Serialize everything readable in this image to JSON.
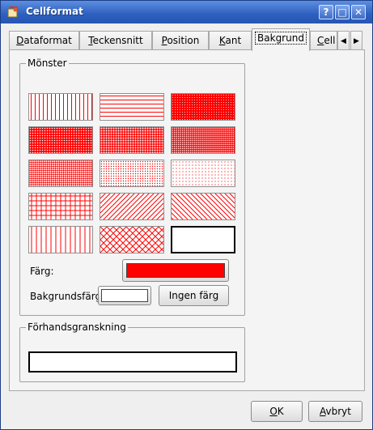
{
  "window": {
    "title": "Cellformat",
    "controls": {
      "help": "?",
      "maximize": "□",
      "close": "✕"
    }
  },
  "tabs": [
    {
      "label": "Dataformat",
      "active": false
    },
    {
      "label": "Teckensnitt",
      "active": false
    },
    {
      "label": "Position",
      "active": false
    },
    {
      "label": "Kant",
      "active": false
    },
    {
      "label": "Bakgrund",
      "active": true
    },
    {
      "label": "Cell",
      "active": false
    }
  ],
  "tab_scroll": {
    "left": "◀",
    "right": "▶"
  },
  "pattern_group": {
    "title": "Mönster",
    "pattern_color": "#ff0000",
    "patterns": [
      "vertical-lines",
      "horizontal-lines",
      "dense-dots-90",
      "dense-dots-75",
      "dense-dots-60",
      "dense-dots-50",
      "dots-40",
      "dots-25",
      "dots-10",
      "grid",
      "diagonal-up",
      "diagonal-down",
      "vertical-lines-fine",
      "cross-hatch",
      "none"
    ],
    "selected_pattern": "none",
    "color_label": "Färg:",
    "color_value": "#ff0000",
    "bg_label": "Bakgrundsfärg:",
    "bg_value": "#ffffff",
    "no_color_button": "Ingen färg"
  },
  "preview_group": {
    "title": "Förhandsgranskning"
  },
  "footer": {
    "ok": "OK",
    "cancel": "Avbryt"
  }
}
